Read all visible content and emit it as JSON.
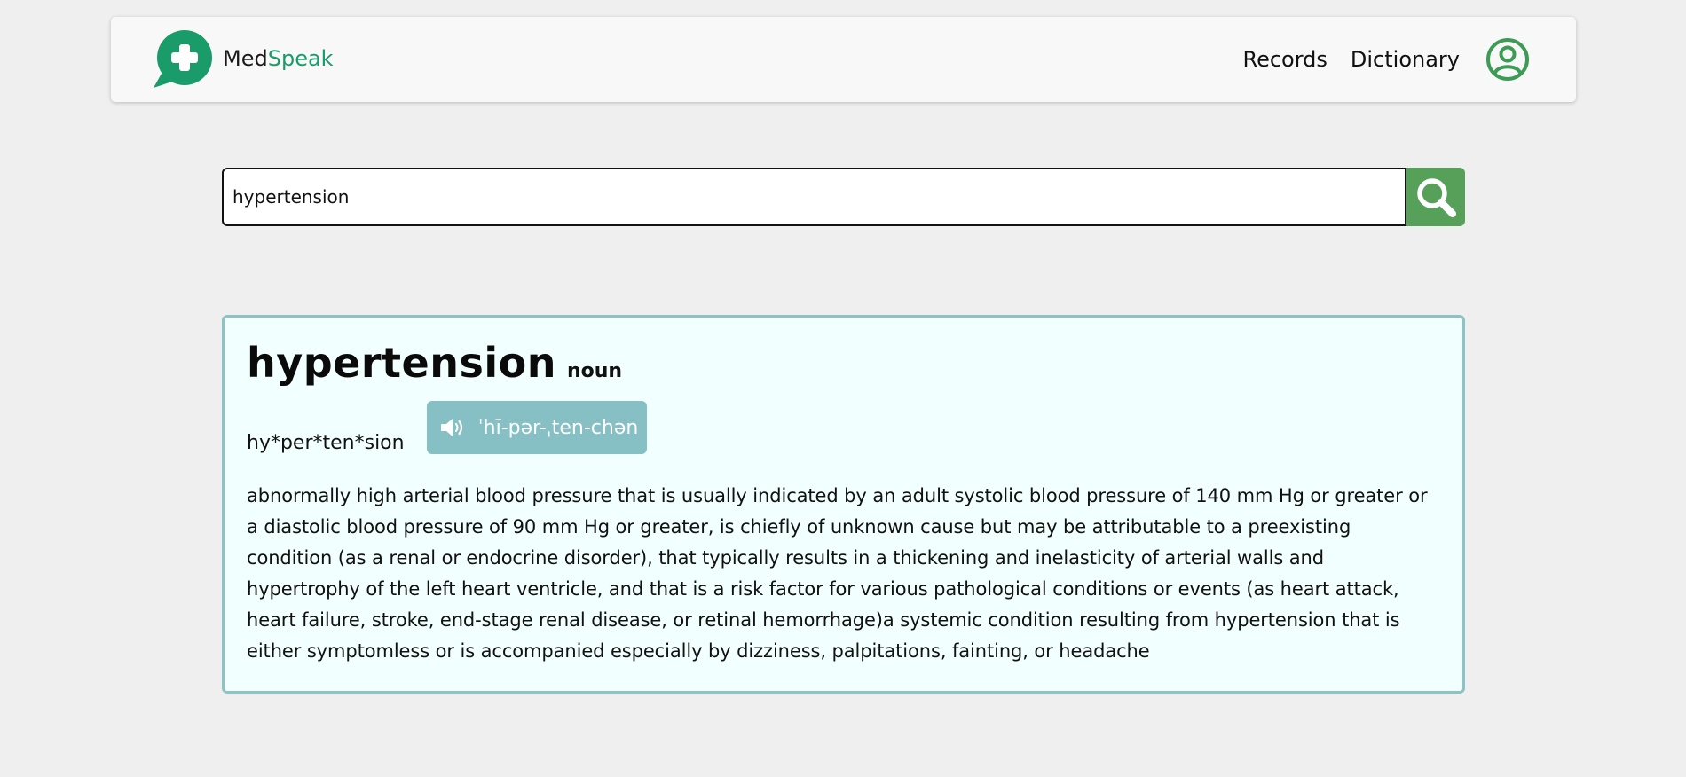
{
  "header": {
    "brand_prefix": "Med",
    "brand_suffix": "Speak",
    "nav": [
      {
        "label": "Records"
      },
      {
        "label": "Dictionary"
      }
    ],
    "profile_icon": "user-circle-icon"
  },
  "search": {
    "value": "hypertension",
    "button_icon": "search-icon"
  },
  "entry": {
    "word": "hypertension",
    "part_of_speech": "noun",
    "syllables": "hy*per*ten*sion",
    "pronunciation": "ˈhī-pər-ˌten-chən",
    "definition": "abnormally high arterial blood pressure that is usually indicated by an adult systolic blood pressure of 140 mm Hg or greater or a diastolic blood pressure of 90 mm Hg or greater, is chiefly of unknown cause but may be attributable to a preexisting condition (as a renal or endocrine disorder), that typically results in a thickening and inelasticity of arterial walls and hypertrophy of the left heart ventricle, and that is a risk factor for various pathological conditions or events (as heart attack, heart failure, stroke, end-stage renal disease, or retinal hemorrhage)a systemic condition resulting from hypertension that is either symptomless or is accompanied especially by dizziness, palpitations, fainting, or headache"
  },
  "colors": {
    "brand_green": "#1a9b6a",
    "search_button": "#57a05a",
    "card_border": "#8ec3c5",
    "card_background": "#f1fffe",
    "audio_button": "#86c0c4"
  }
}
